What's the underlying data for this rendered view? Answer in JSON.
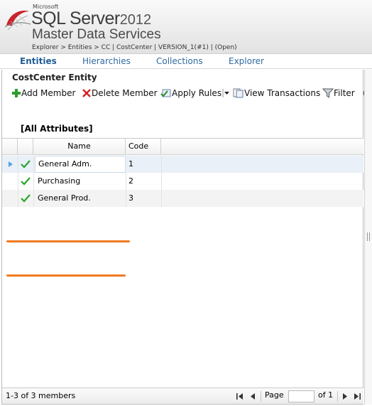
{
  "header": {
    "brand_small": "Microsoft",
    "product": "SQL Server",
    "version": "2012",
    "subtitle": "Master Data Services",
    "breadcrumb": "Explorer > Entities > CC | CostCenter | VERSION_1(#1) | (Open)"
  },
  "nav": {
    "tabs": [
      {
        "label": "Entities",
        "active": true
      },
      {
        "label": "Hierarchies",
        "active": false
      },
      {
        "label": "Collections",
        "active": false
      },
      {
        "label": "Explorer",
        "active": false
      }
    ]
  },
  "entity": {
    "title": "CostCenter Entity",
    "attribute_set": "[All Attributes]"
  },
  "toolbar": {
    "add_member": "Add Member",
    "delete_member": "Delete Member",
    "apply_rules": "Apply Rules",
    "view_transactions": "View Transactions",
    "filter": "Filter"
  },
  "grid": {
    "columns": [
      "Name",
      "Code"
    ],
    "rows": [
      {
        "name": "General Adm.",
        "code": "1",
        "valid": true,
        "selected": true
      },
      {
        "name": "Purchasing",
        "code": "2",
        "valid": true,
        "selected": false
      },
      {
        "name": "General Prod.",
        "code": "3",
        "valid": true,
        "selected": false
      }
    ]
  },
  "footer": {
    "count": "1-3 of 3 members",
    "page_label": "Page",
    "page_value": "",
    "of_label": "of 1"
  },
  "colors": {
    "accent": "#1e5c96",
    "valid_check": "#2aa52a",
    "annotation": "#f07a20",
    "delete_x": "#d42020"
  }
}
